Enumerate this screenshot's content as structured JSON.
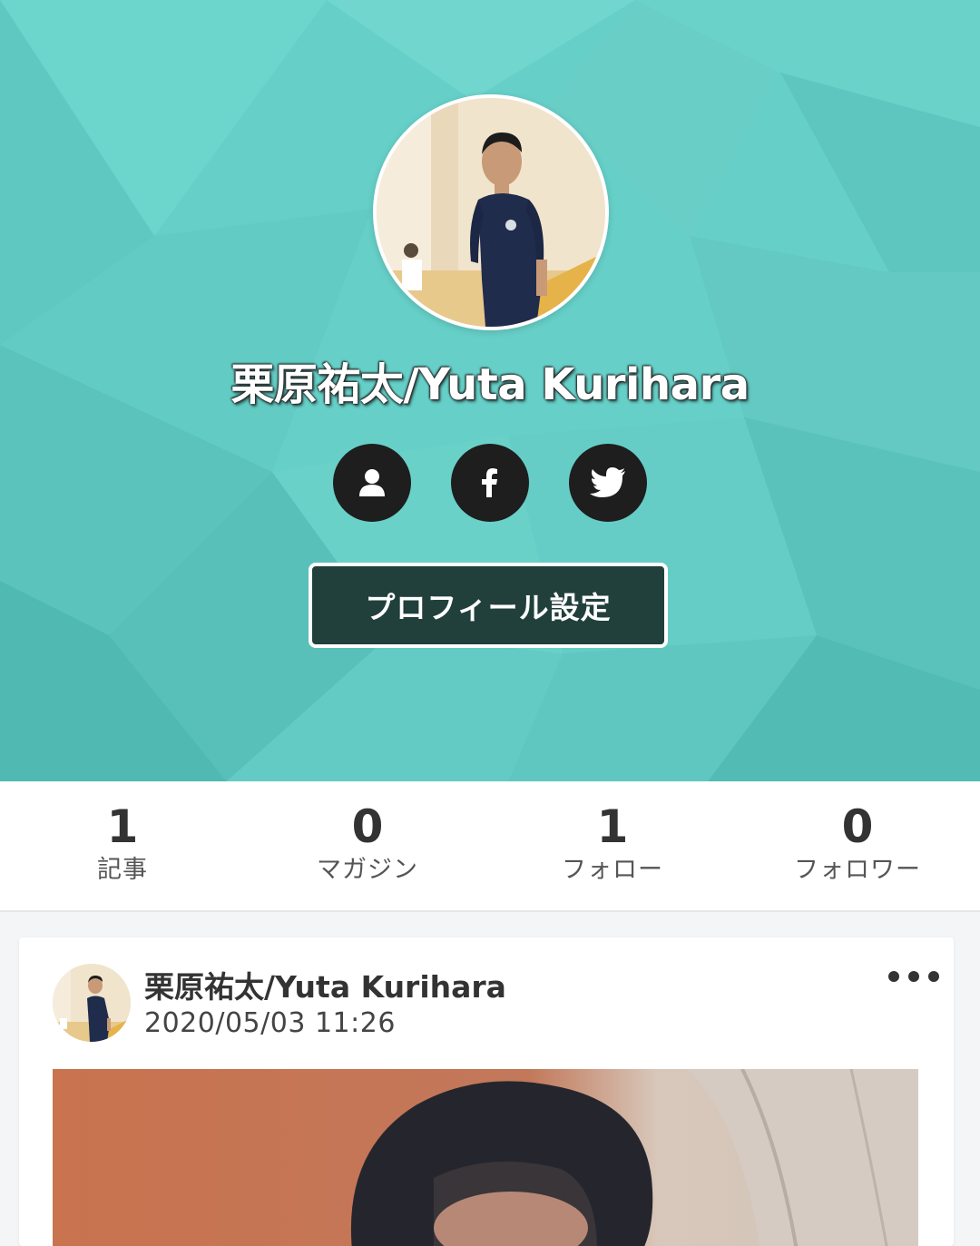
{
  "profile": {
    "name": "栗原祐太/Yuta Kurihara",
    "settings_button": "プロフィール設定",
    "social": [
      {
        "icon": "profile-icon"
      },
      {
        "icon": "facebook-icon"
      },
      {
        "icon": "twitter-icon"
      }
    ]
  },
  "stats": [
    {
      "count": "1",
      "label": "記事"
    },
    {
      "count": "0",
      "label": "マガジン"
    },
    {
      "count": "1",
      "label": "フォロー"
    },
    {
      "count": "0",
      "label": "フォロワー"
    }
  ],
  "post": {
    "author": "栗原祐太/Yuta Kurihara",
    "date": "2020/05/03 11:26",
    "menu_icon": "more-dots-icon"
  },
  "colors": {
    "header_bg": "#66d0c8",
    "settings_button_bg": "#21403c",
    "social_button_bg": "#1e1e1e"
  }
}
